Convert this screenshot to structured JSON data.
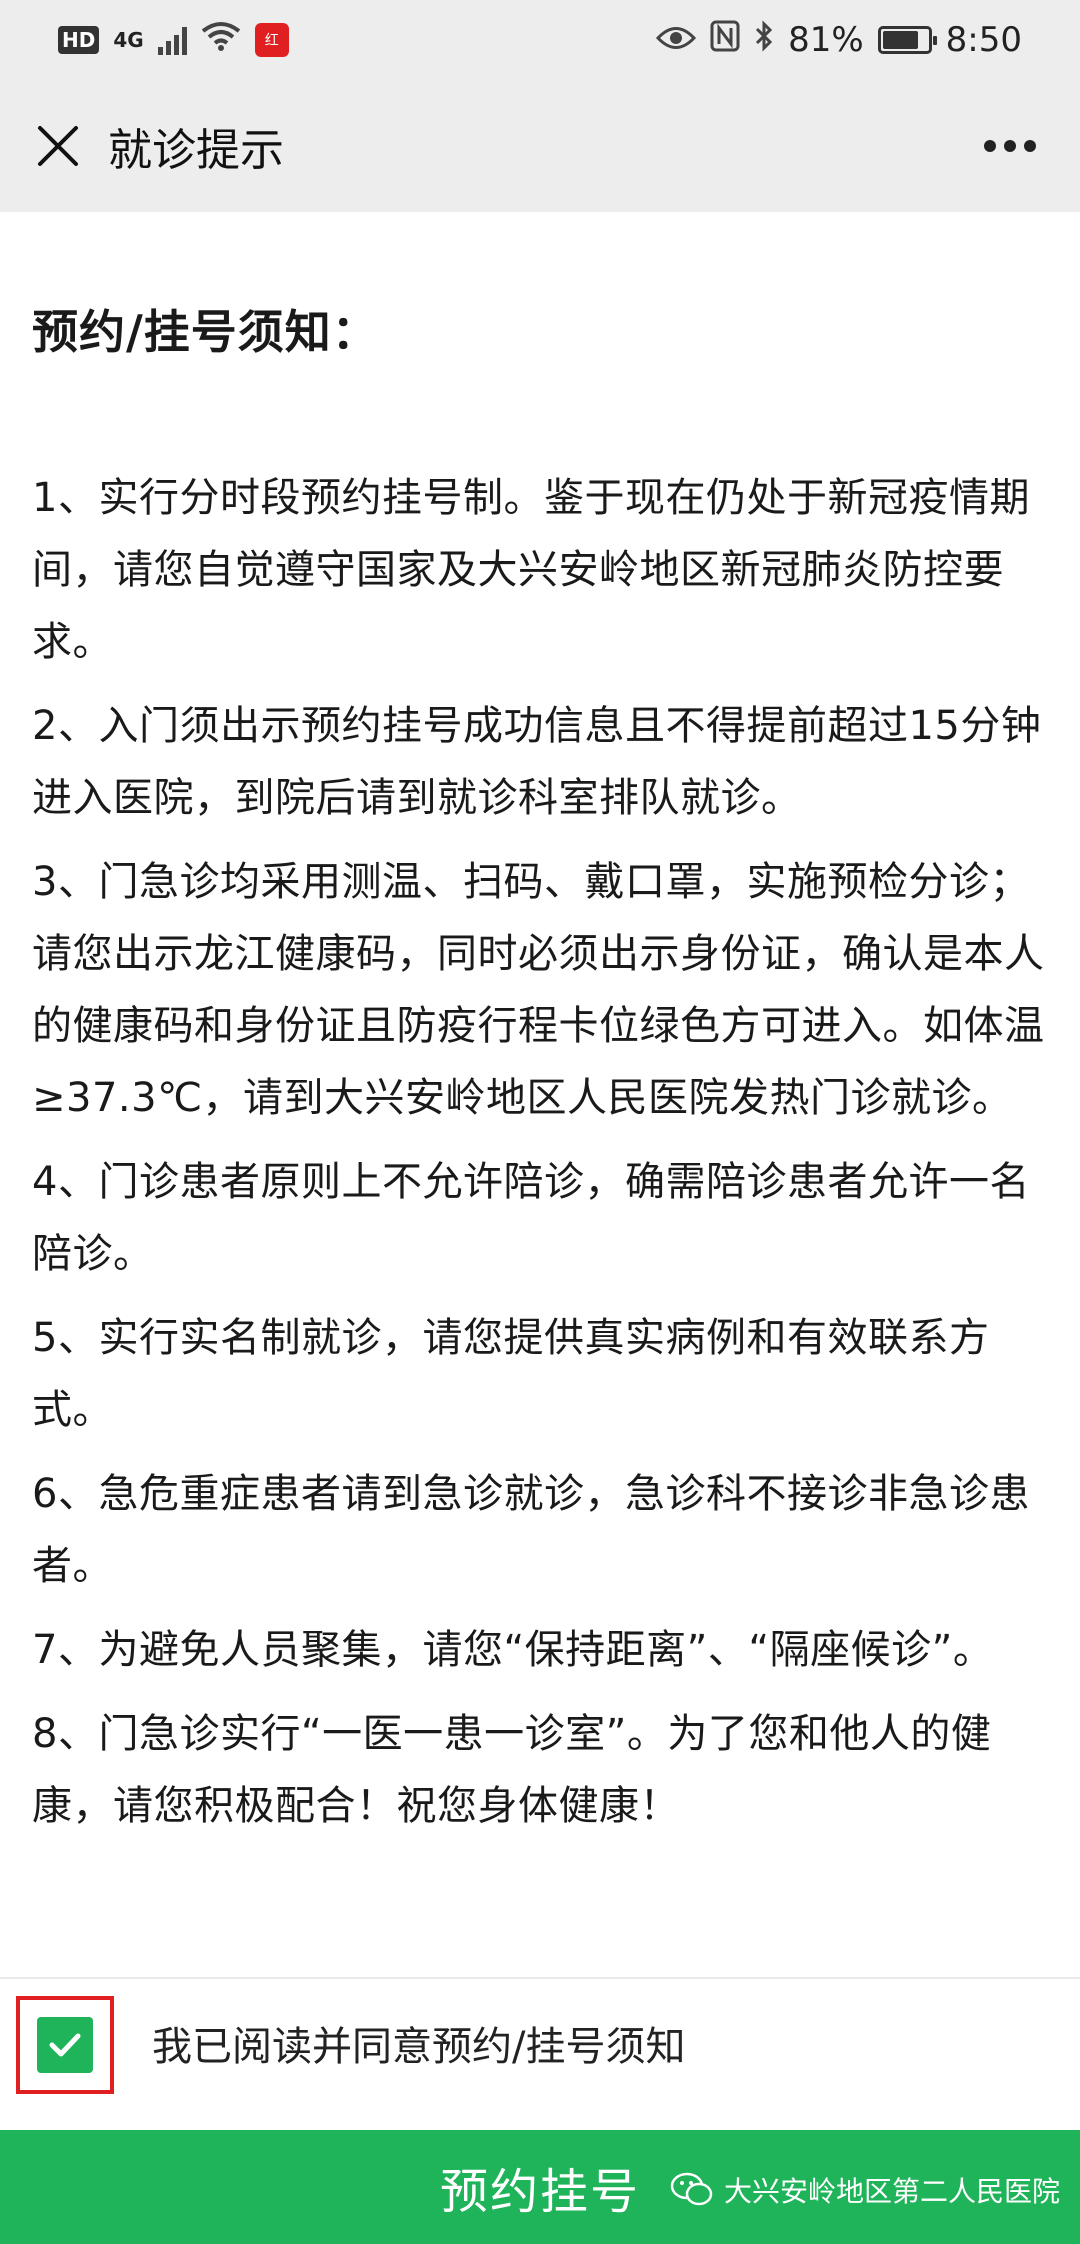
{
  "status_bar": {
    "network_badge": "HD",
    "network_type": "4G",
    "app_icon_text": "红",
    "battery": "81%",
    "time": "8:50"
  },
  "nav": {
    "title": "就诊提示"
  },
  "heading": "预约/挂号须知：",
  "notices": [
    "1、实行分时段预约挂号制。鉴于现在仍处于新冠疫情期间，请您自觉遵守国家及大兴安岭地区新冠肺炎防控要求。",
    "2、入门须出示预约挂号成功信息且不得提前超过15分钟进入医院，到院后请到就诊科室排队就诊。",
    "3、门急诊均采用测温、扫码、戴口罩，实施预检分诊；请您出示龙江健康码，同时必须出示身份证，确认是本人的健康码和身份证且防疫行程卡位绿色方可进入。如体温≥37.3℃，请到大兴安岭地区人民医院发热门诊就诊。",
    "4、门诊患者原则上不允许陪诊，确需陪诊患者允许一名陪诊。",
    "5、实行实名制就诊，请您提供真实病例和有效联系方式。",
    "6、急危重症患者请到急诊就诊，急诊科不接诊非急诊患者。",
    "7、为避免人员聚集，请您“保持距离”、“隔座候诊”。",
    "8、门急诊实行“一医一患一诊室”。为了您和他人的健康，请您积极配合！祝您身体健康！"
  ],
  "agreement": {
    "label": "我已阅读并同意预约/挂号须知",
    "checked": true
  },
  "book_button": {
    "label": "预约挂号"
  },
  "watermark": {
    "text": "大兴安岭地区第二人民医院"
  },
  "colors": {
    "accent_green": "#1fb35a",
    "highlight_red": "#e02020",
    "header_bg": "#ededed"
  }
}
